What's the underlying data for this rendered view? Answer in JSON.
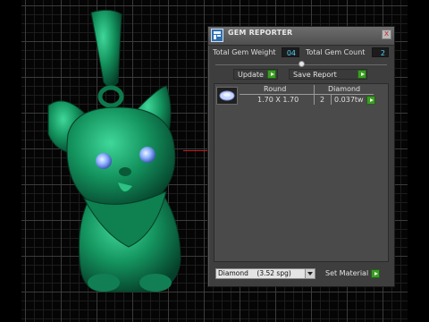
{
  "window": {
    "title": "GEM REPORTER",
    "close_glyph": "x"
  },
  "summary": {
    "weight_label": "Total Gem Weight",
    "weight_value": "04",
    "count_label": "Total Gem Count",
    "count_value": "2",
    "slider_level": 0.5
  },
  "actions": {
    "update_label": "Update",
    "save_label": "Save Report"
  },
  "gem_table": {
    "columns": [
      "Round",
      "Diamond"
    ],
    "rows": [
      {
        "icon": "round-diamond-icon",
        "size": "1.70 X 1.70",
        "count": "2",
        "weight": "0.037tw"
      }
    ]
  },
  "material": {
    "selected": "Diamond    (3.52 spg)",
    "set_label": "Set Material"
  },
  "colors": {
    "panel_bg": "#3e3e3e",
    "value_text": "#4fd3ff",
    "go_button": "#3c9c27",
    "model_green": "#138a5a",
    "gem_blue": "#8fb3ff"
  }
}
